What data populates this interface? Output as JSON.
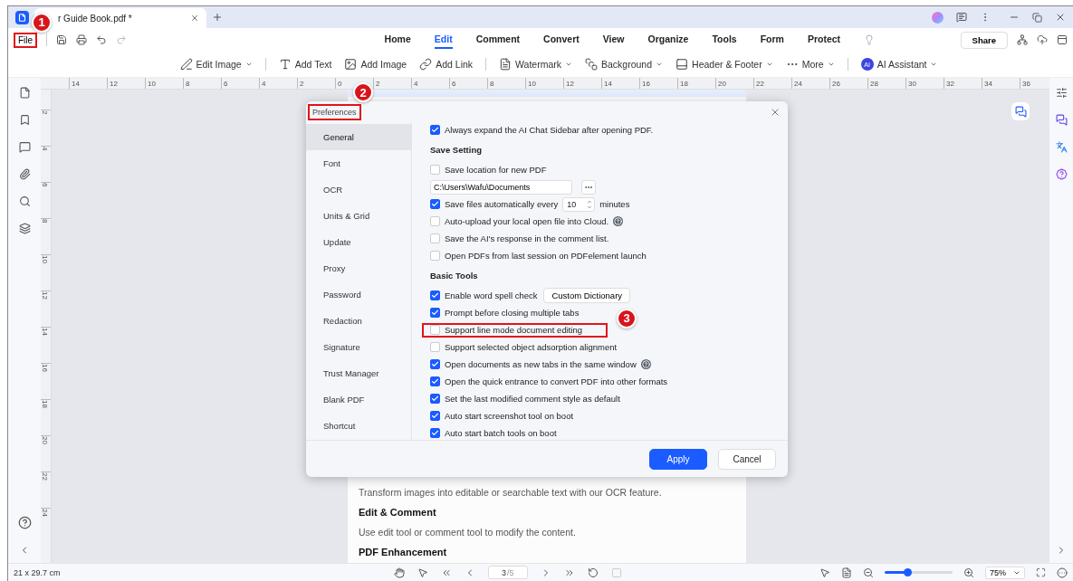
{
  "document_tab": {
    "title": "r Guide Book.pdf *"
  },
  "file_menu": {
    "label": "File",
    "highlighted": true,
    "badge": "1"
  },
  "menu_tabs": [
    {
      "label": "Home",
      "selected": false
    },
    {
      "label": "Edit",
      "selected": true
    },
    {
      "label": "Comment",
      "selected": false
    },
    {
      "label": "Convert",
      "selected": false
    },
    {
      "label": "View",
      "selected": false
    },
    {
      "label": "Organize",
      "selected": false
    },
    {
      "label": "Tools",
      "selected": false
    },
    {
      "label": "Form",
      "selected": false
    },
    {
      "label": "Protect",
      "selected": false
    }
  ],
  "share_button": "Share",
  "toolbar": [
    {
      "kind": "edit-image",
      "label": "Edit Image",
      "dropdown": true
    },
    {
      "kind": "divider"
    },
    {
      "kind": "text",
      "label": "Add Text",
      "dropdown": false
    },
    {
      "kind": "image",
      "label": "Add Image",
      "dropdown": false
    },
    {
      "kind": "link",
      "label": "Add Link",
      "dropdown": false
    },
    {
      "kind": "divider"
    },
    {
      "kind": "watermark",
      "label": "Watermark",
      "dropdown": true
    },
    {
      "kind": "background",
      "label": "Background",
      "dropdown": true
    },
    {
      "kind": "header",
      "label": "Header & Footer",
      "dropdown": true
    },
    {
      "kind": "more",
      "label": "More",
      "dropdown": true
    },
    {
      "kind": "divider"
    },
    {
      "kind": "ai",
      "icon_text": "AI",
      "label": "AI Assistant",
      "dropdown": true
    }
  ],
  "ruler": {
    "horizontal": [
      "14",
      "12",
      "10",
      "8",
      "6",
      "4",
      "2",
      "0",
      "2",
      "4",
      "6",
      "8",
      "10",
      "12",
      "14",
      "16",
      "18",
      "20",
      "22",
      "24",
      "26",
      "28",
      "30",
      "32",
      "34",
      "36"
    ],
    "vertical": [
      "2",
      "4",
      "6",
      "8",
      "10",
      "12",
      "14",
      "16",
      "18",
      "20",
      "22",
      "24"
    ]
  },
  "page": {
    "paragraphs": [
      {
        "kind": "text",
        "text": "Transform images into editable or searchable text with our OCR feature."
      },
      {
        "kind": "heading",
        "text": "Edit & Comment"
      },
      {
        "kind": "text",
        "text": "Use edit tool or comment tool to modify the content."
      },
      {
        "kind": "heading",
        "text": "PDF Enhancement"
      }
    ]
  },
  "dialog": {
    "title": "Preferences",
    "highlighted": true,
    "badge": "2",
    "nav": [
      {
        "label": "General",
        "selected": true
      },
      {
        "label": "Font",
        "selected": false
      },
      {
        "label": "OCR",
        "selected": false
      },
      {
        "label": "Units & Grid",
        "selected": false
      },
      {
        "label": "Update",
        "selected": false
      },
      {
        "label": "Proxy",
        "selected": false
      },
      {
        "label": "Password",
        "selected": false
      },
      {
        "label": "Redaction",
        "selected": false
      },
      {
        "label": "Signature",
        "selected": false
      },
      {
        "label": "Trust Manager",
        "selected": false
      },
      {
        "label": "Blank PDF",
        "selected": false
      },
      {
        "label": "Shortcut",
        "selected": false
      }
    ],
    "options": [
      {
        "kind": "checkbox",
        "label": "Always expand the AI Chat Sidebar after opening PDF.",
        "checked": true
      },
      {
        "kind": "heading",
        "label": "Save Setting"
      },
      {
        "kind": "checkbox",
        "label": "Save location for new PDF",
        "checked": false
      },
      {
        "kind": "path",
        "value": "C:\\Users\\Wafu\\Documents"
      },
      {
        "kind": "spin",
        "label": "Save files automatically every",
        "checked": true,
        "value": "10",
        "unit": "minutes"
      },
      {
        "kind": "checkbox",
        "label": "Auto-upload your local open file into Cloud.",
        "checked": false,
        "help": true
      },
      {
        "kind": "checkbox",
        "label": "Save the AI's response in the comment list.",
        "checked": false
      },
      {
        "kind": "checkbox",
        "label": "Open PDFs from last session on PDFelement launch",
        "checked": false
      },
      {
        "kind": "heading",
        "label": "Basic Tools"
      },
      {
        "kind": "checkbox",
        "label": "Enable word spell check",
        "checked": true,
        "button": "Custom Dictionary"
      },
      {
        "kind": "checkbox",
        "label": "Prompt before closing multiple tabs",
        "checked": true
      },
      {
        "kind": "checkbox",
        "label": "Support line mode document editing",
        "checked": false,
        "highlighted": true,
        "badge": "3"
      },
      {
        "kind": "checkbox",
        "label": "Support selected object adsorption alignment",
        "checked": false
      },
      {
        "kind": "checkbox",
        "label": "Open documents as new tabs in the same window",
        "checked": true,
        "help": true
      },
      {
        "kind": "checkbox",
        "label": "Open the quick entrance to convert PDF into other formats",
        "checked": true
      },
      {
        "kind": "checkbox",
        "label": "Set the last modified comment style as default",
        "checked": true
      },
      {
        "kind": "checkbox",
        "label": "Auto start screenshot tool on boot",
        "checked": true
      },
      {
        "kind": "checkbox",
        "label": "Auto start batch tools on boot",
        "checked": true
      }
    ],
    "buttons": [
      {
        "label": "Apply",
        "primary": true
      },
      {
        "label": "Cancel",
        "primary": false
      }
    ]
  },
  "status_bar": {
    "size": "21 x 29.7 cm",
    "page": "3",
    "page_total": "/5",
    "zoom": "75%",
    "zoom_slider": {
      "level": 0.33
    }
  }
}
